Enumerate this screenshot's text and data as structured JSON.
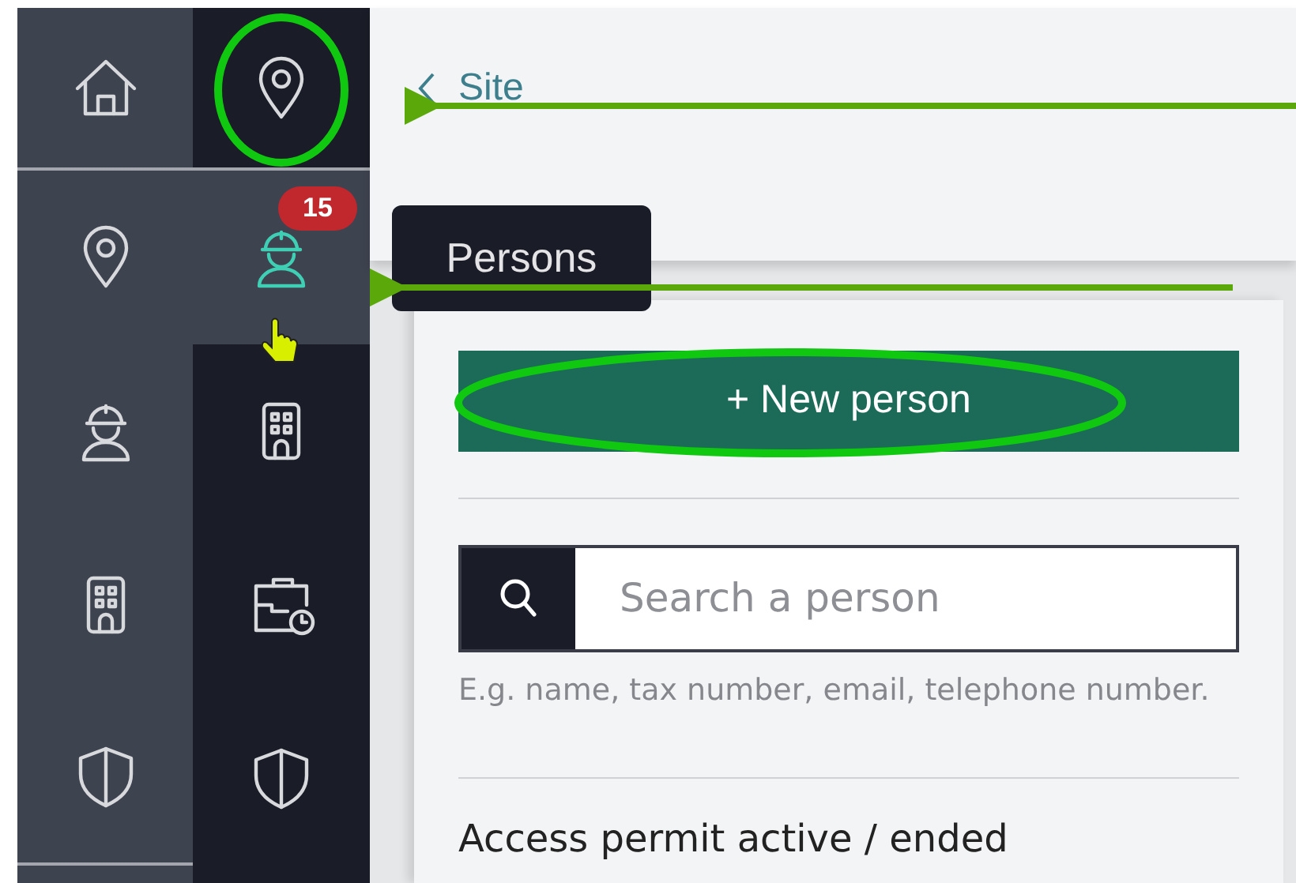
{
  "primary_nav": [
    {
      "kind": "home"
    },
    {
      "kind": "pin"
    },
    {
      "kind": "worker"
    },
    {
      "kind": "building"
    },
    {
      "kind": "shield"
    }
  ],
  "secondary_nav": [
    {
      "kind": "pin",
      "selected": false
    },
    {
      "kind": "worker",
      "selected": true,
      "badge": "15"
    },
    {
      "kind": "building",
      "selected": false
    },
    {
      "kind": "briefcase",
      "selected": false
    },
    {
      "kind": "shield",
      "selected": false
    }
  ],
  "tooltip": {
    "text": "Persons"
  },
  "header": {
    "back_link": "Site"
  },
  "panel": {
    "new_button": "+ New person",
    "search": {
      "placeholder": "Search a person",
      "help": "E.g. name, tax number, email, telephone number."
    },
    "section_title": "Access permit active / ended"
  }
}
